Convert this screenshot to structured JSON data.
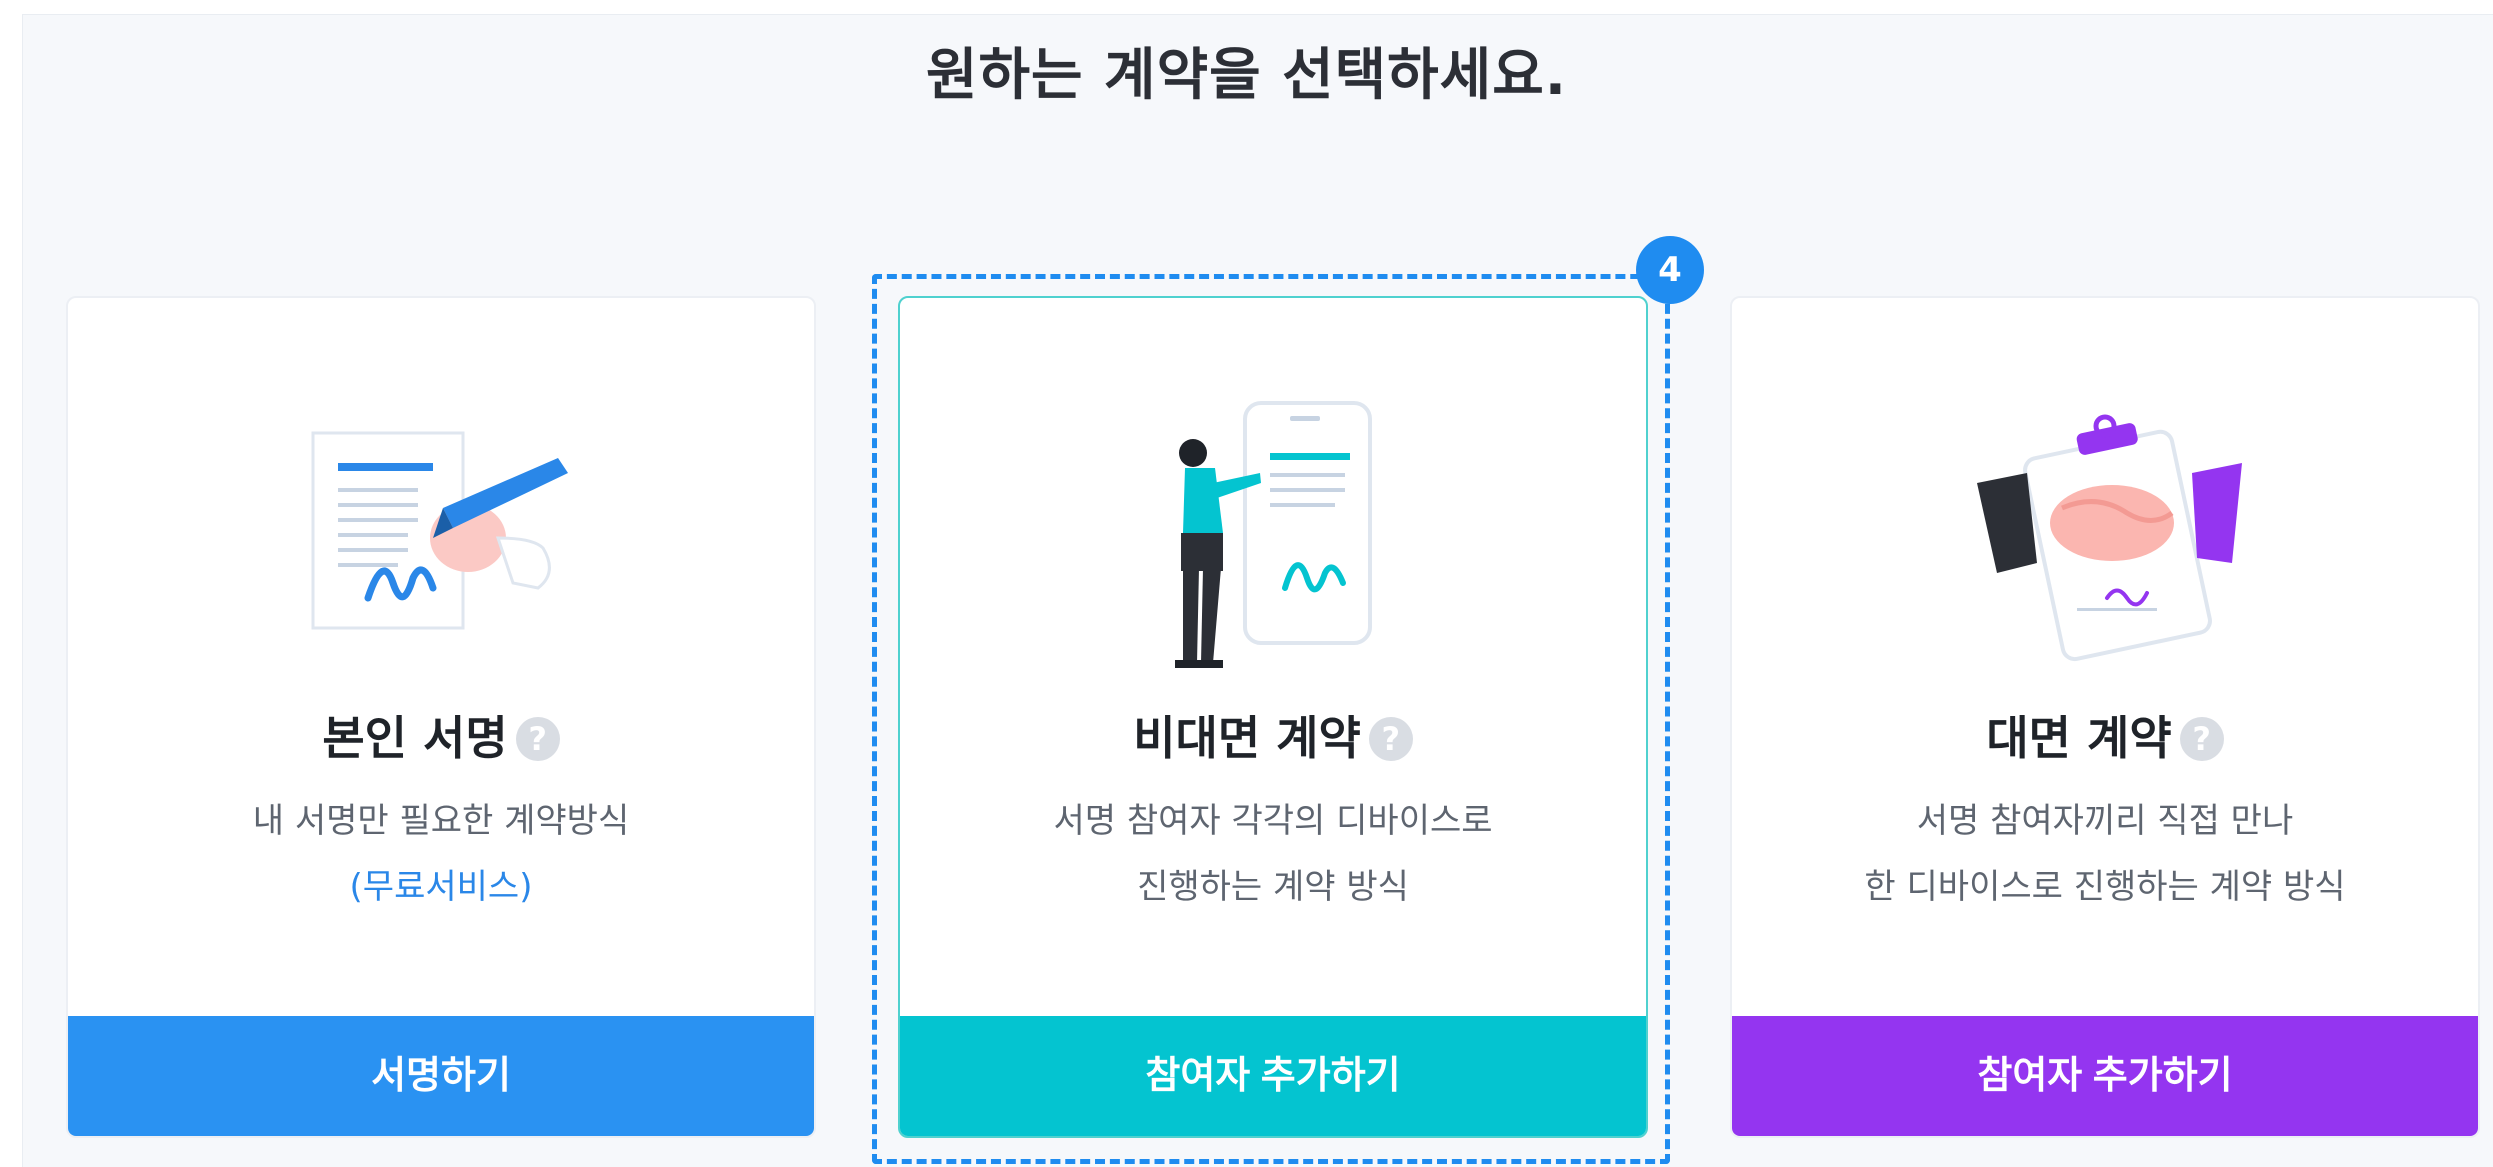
{
  "header": {
    "title": "원하는 계약을 선택하세요."
  },
  "cards": [
    {
      "title": "본인 서명",
      "help_icon": "?",
      "desc_line1": "내 서명만 필요한 계약방식",
      "desc_line2": "(무료서비스)",
      "button": "서명하기",
      "accent": "#2a92f2"
    },
    {
      "title": "비대면 계약",
      "help_icon": "?",
      "desc_line1": "서명 참여자 각각의 디바이스로",
      "desc_line2": "진행하는 계약 방식",
      "button": "참여자 추가하기",
      "accent": "#04c4d0"
    },
    {
      "title": "대면 계약",
      "help_icon": "?",
      "desc_line1": "서명 참여자끼리 직접 만나",
      "desc_line2": "한 디바이스로 진행하는 계약 방식",
      "button": "참여자 추가하기",
      "accent": "#9435f0"
    }
  ],
  "highlight": {
    "step": "4",
    "color": "#1f8cf0"
  },
  "icons": [
    "signature-document-icon",
    "mobile-contract-icon",
    "handshake-contract-icon",
    "help-icon"
  ]
}
